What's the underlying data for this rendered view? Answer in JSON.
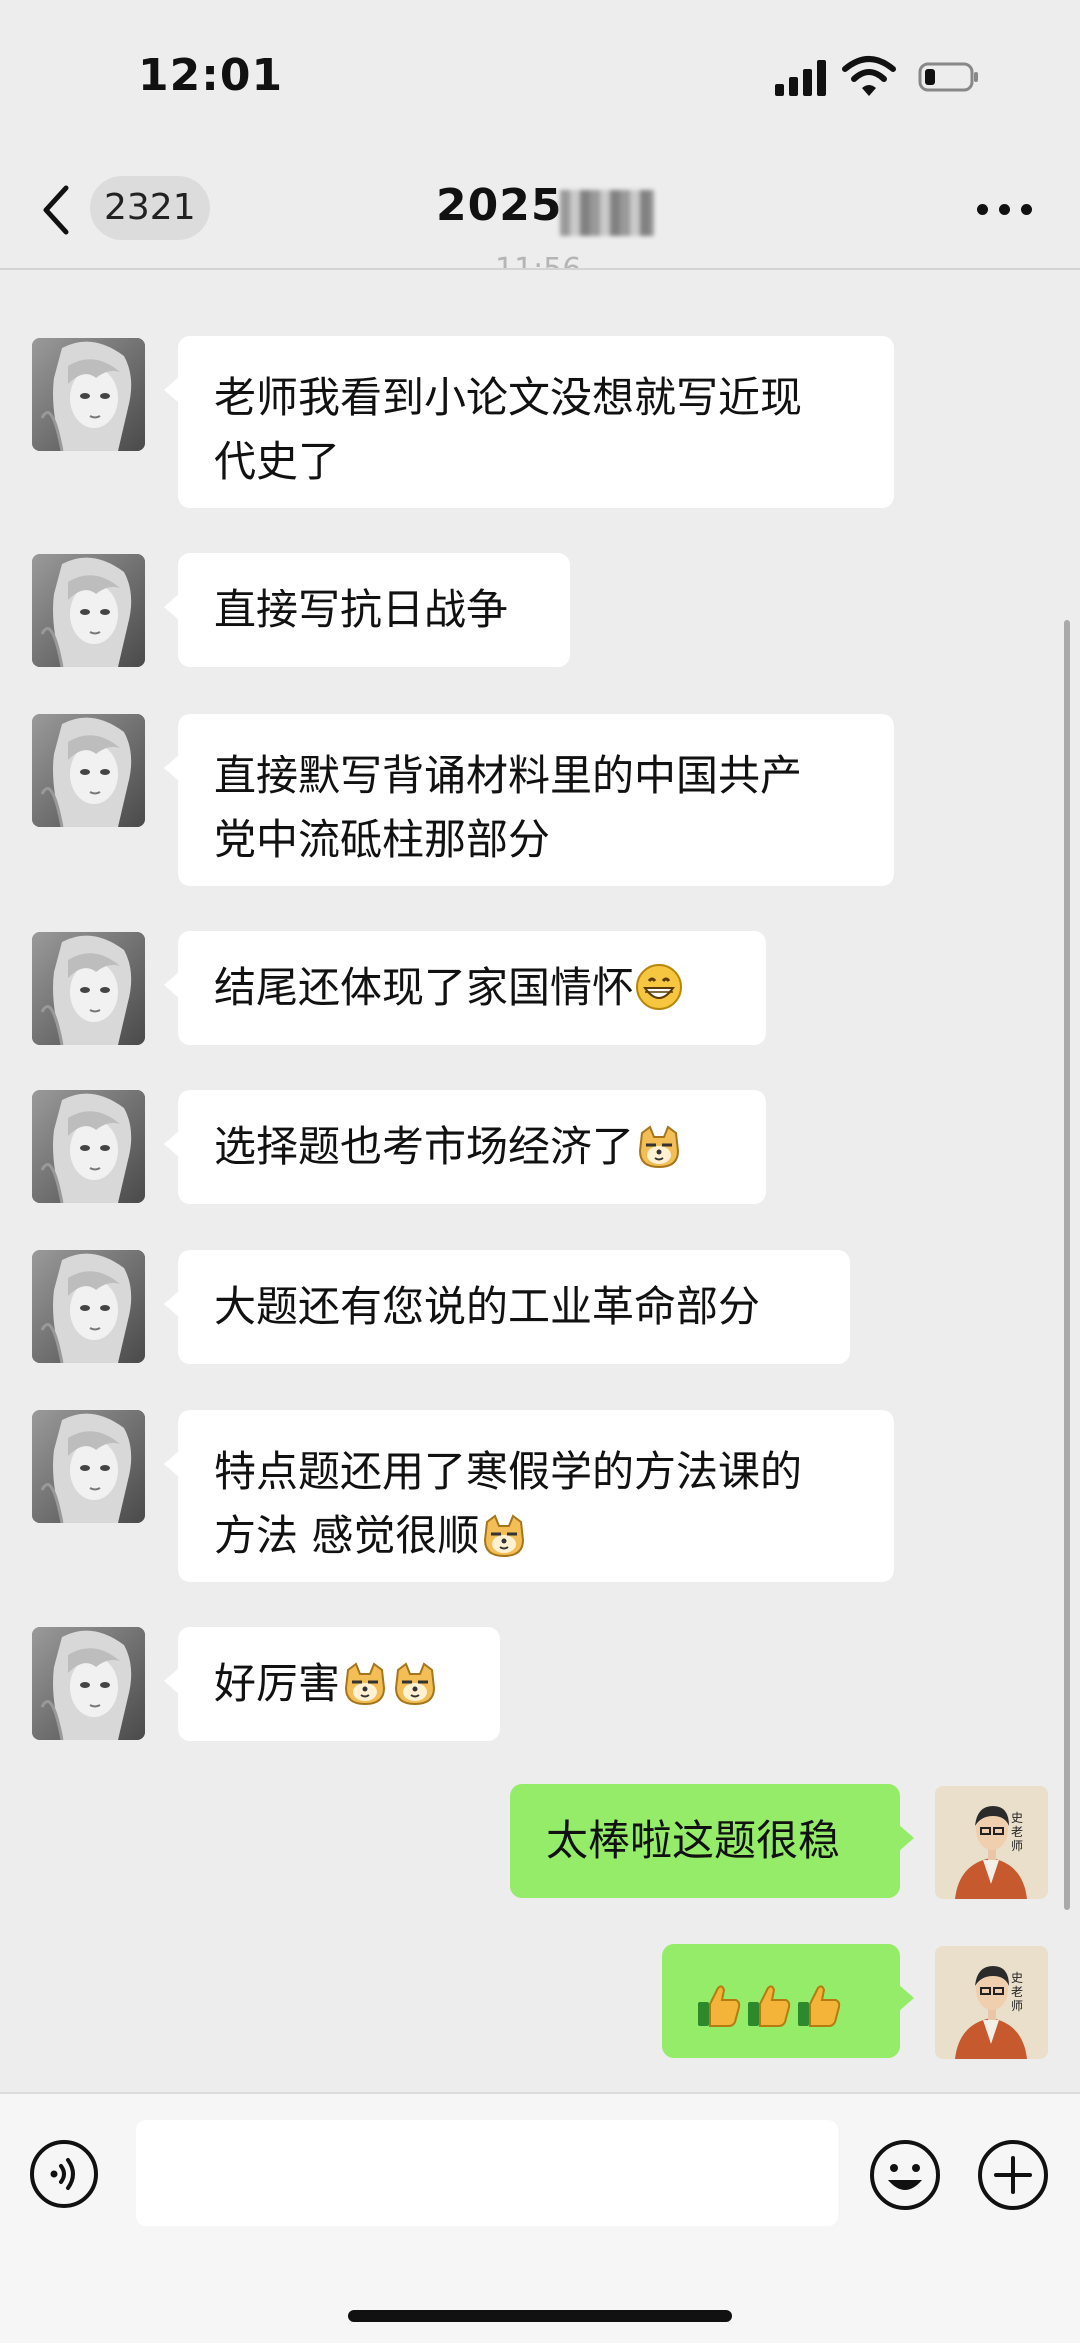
{
  "status": {
    "time": "12:01"
  },
  "header": {
    "badge": "2321",
    "title": "2025"
  },
  "conversation": {
    "timestamp_fragment": "11:56",
    "incoming": [
      {
        "line1": "老师我看到小论文没想就写近现",
        "line2": "代史了"
      },
      {
        "line1": "直接写抗日战争"
      },
      {
        "line1": "直接默写背诵材料里的中国共产",
        "line2": "党中流砥柱那部分"
      },
      {
        "line1": "结尾还体现了家国情怀",
        "emoji": [
          "grin-emoji"
        ]
      },
      {
        "line1": "选择题也考市场经济了",
        "emoji": [
          "doge-emoji"
        ]
      },
      {
        "line1": "大题还有您说的工业革命部分"
      },
      {
        "line1": "特点题还用了寒假学的方法课的",
        "line2": "方法 感觉很顺",
        "emoji": [
          "doge-emoji"
        ]
      },
      {
        "line1": "好厉害",
        "emoji": [
          "doge-emoji",
          "doge-emoji"
        ]
      }
    ],
    "outgoing": [
      {
        "text": "太棒啦这题很稳"
      },
      {
        "emoji": [
          "thumbs-up-emoji",
          "thumbs-up-emoji",
          "thumbs-up-emoji"
        ]
      }
    ],
    "outgoing_avatar_label": "史老师"
  },
  "icons": {
    "back": "chevron-left-icon",
    "more": "more-dots-icon",
    "voice": "voice-icon",
    "emoji_button": "emoji-icon",
    "plus": "plus-icon"
  },
  "colors": {
    "incoming_bubble": "#ffffff",
    "outgoing_bubble": "#95ec69",
    "background": "#ededed"
  }
}
